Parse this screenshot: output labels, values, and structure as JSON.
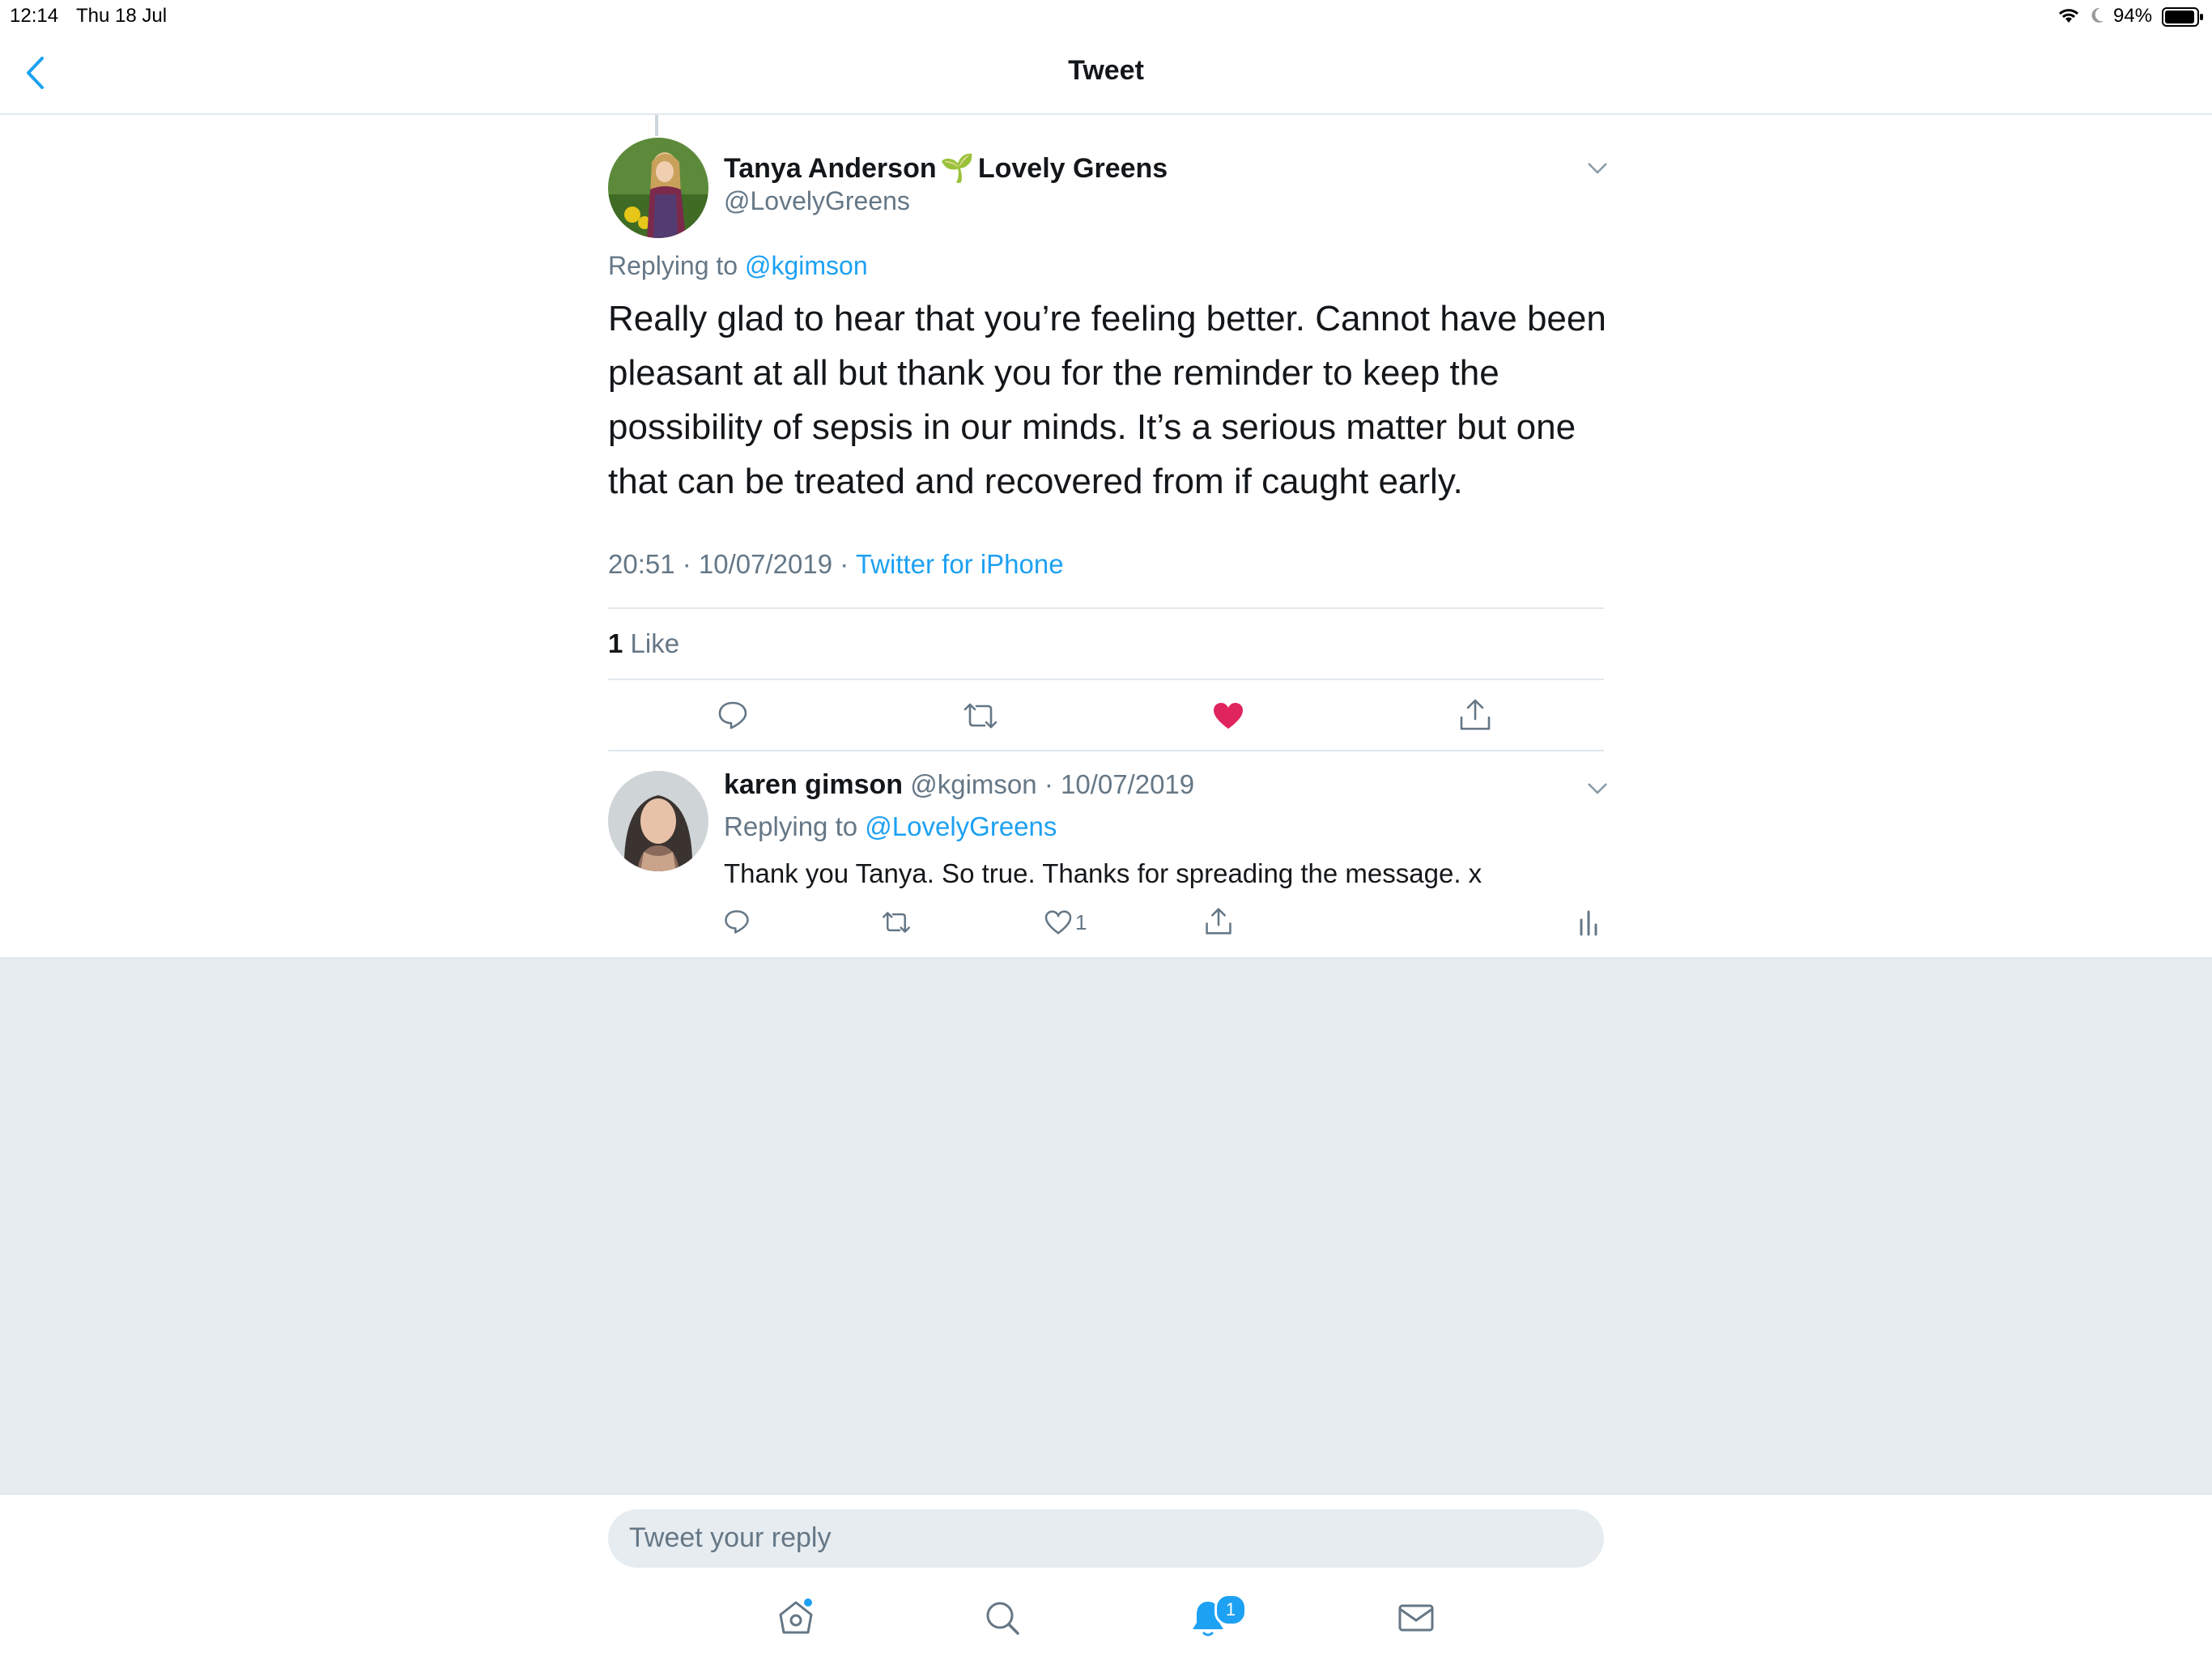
{
  "status_bar": {
    "time": "12:14",
    "date": "Thu 18 Jul",
    "battery": "94%",
    "icons": [
      "wifi-icon",
      "moon-icon",
      "battery-icon"
    ]
  },
  "nav": {
    "title": "Tweet",
    "back_icon": "chevron-left-icon"
  },
  "main_tweet": {
    "display_name": "Tanya Anderson",
    "name_emoji": "🌱",
    "display_name_suffix": "Lovely Greens",
    "handle": "@LovelyGreens",
    "replying_prefix": "Replying to",
    "replying_handle": "@kgimson",
    "text_lines": [
      "Really glad to hear that you’re feeling better. Cannot have been",
      "pleasant at all but thank you for the reminder to keep the",
      "possibility of sepsis in our minds. It’s a serious matter but one",
      "that can be treated and recovered from if caught early."
    ],
    "timestamp": "20:51 · 10/07/2019 ·",
    "source": "Twitter for iPhone",
    "likes_count": "1",
    "likes_label": "Like",
    "liked": true,
    "colors": {
      "heart": "#e0245e",
      "icon": "#657786",
      "link": "#1da1f2"
    }
  },
  "reply": {
    "display_name": "karen gimson",
    "handle": "@kgimson",
    "date": "· 10/07/2019",
    "replying_prefix": "Replying to",
    "replying_handle": "@LovelyGreens",
    "text": "Thank you Tanya. So true. Thanks for spreading the message. x",
    "likes_count": "1"
  },
  "composer": {
    "placeholder": "Tweet your reply"
  },
  "tab_bar": {
    "items": [
      "home-icon",
      "search-icon",
      "notifications-icon",
      "messages-icon"
    ],
    "notification_badge": "1",
    "accent": "#1da1f2"
  }
}
